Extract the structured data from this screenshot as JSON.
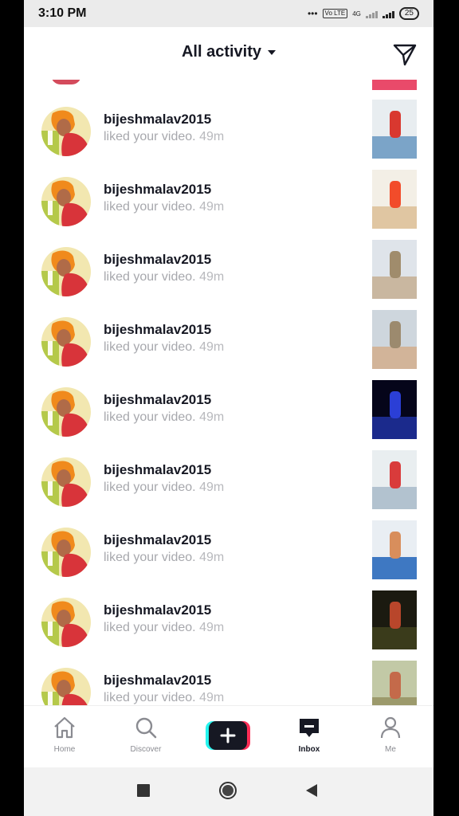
{
  "status": {
    "time": "3:10 PM",
    "signal": "4G",
    "volte": "Vo LTE",
    "battery": "25"
  },
  "header": {
    "title": "All activity"
  },
  "activities": [
    {
      "user": "bijeshmalav2015",
      "message": "liked your video.",
      "time": "49m"
    },
    {
      "user": "bijeshmalav2015",
      "message": "liked your video.",
      "time": "49m"
    },
    {
      "user": "bijeshmalav2015",
      "message": "liked your video.",
      "time": "49m"
    },
    {
      "user": "bijeshmalav2015",
      "message": "liked your video.",
      "time": "49m"
    },
    {
      "user": "bijeshmalav2015",
      "message": "liked your video.",
      "time": "49m"
    },
    {
      "user": "bijeshmalav2015",
      "message": "liked your video.",
      "time": "49m"
    },
    {
      "user": "bijeshmalav2015",
      "message": "liked your video.",
      "time": "49m"
    },
    {
      "user": "bijeshmalav2015",
      "message": "liked your video.",
      "time": "49m"
    },
    {
      "user": "bijeshmalav2015",
      "message": "liked your video.",
      "time": "49m"
    }
  ],
  "nav": {
    "home": "Home",
    "discover": "Discover",
    "inbox": "Inbox",
    "me": "Me"
  },
  "colors": {
    "accent_cyan": "#25f4ee",
    "accent_red": "#fe2c55",
    "text_primary": "#161823",
    "text_secondary": "#a7a8ad"
  }
}
